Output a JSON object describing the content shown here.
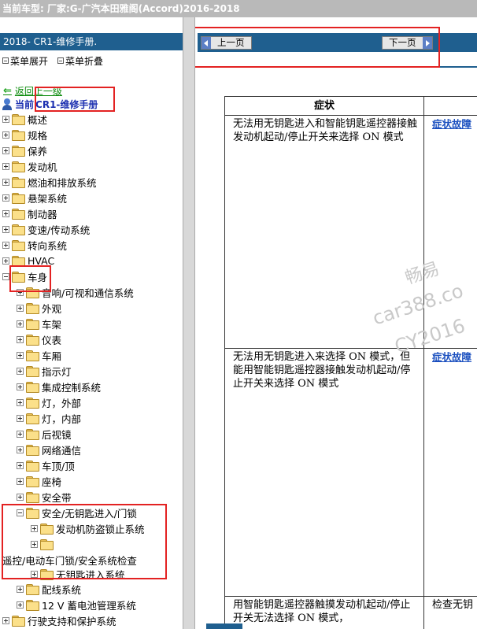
{
  "title_bar": "当前车型:  厂家:G-广汽本田雅阁(Accord)2016-2018",
  "sidebar": {
    "manual_header": "2018- CR1-维修手册.",
    "expand_all": "菜单展开",
    "collapse_all": "菜单折叠",
    "back": "返回上一级",
    "current_prefix": "当前",
    "current_name": "CR1-维修手册",
    "tree": [
      {
        "label": "概述"
      },
      {
        "label": "规格"
      },
      {
        "label": "保养"
      },
      {
        "label": "发动机"
      },
      {
        "label": "燃油和排放系统"
      },
      {
        "label": "悬架系统"
      },
      {
        "label": "制动器"
      },
      {
        "label": "变速/传动系统"
      },
      {
        "label": "转向系统"
      },
      {
        "label": "HVAC"
      },
      {
        "label": "车身"
      },
      {
        "label": "音响/可视和通信系统"
      },
      {
        "label": "外观"
      },
      {
        "label": "车架"
      },
      {
        "label": "仪表"
      },
      {
        "label": "车厢"
      },
      {
        "label": "指示灯"
      },
      {
        "label": "集成控制系统"
      },
      {
        "label": "灯，外部"
      },
      {
        "label": "灯，内部"
      },
      {
        "label": "后视镜"
      },
      {
        "label": "网络通信"
      },
      {
        "label": "车顶/顶"
      },
      {
        "label": "座椅"
      },
      {
        "label": "安全带"
      },
      {
        "label": "安全/无钥匙进入/门锁"
      },
      {
        "label": "发动机防盗锁止系统"
      },
      {
        "label": "遥控/电动车门锁/安全系统检查"
      },
      {
        "label": "无钥匙进入系统"
      },
      {
        "label": "配线系统"
      },
      {
        "label": "12 V 蓄电池管理系统"
      },
      {
        "label": "行驶支持和保护系统"
      }
    ]
  },
  "content": {
    "prev_page": "上一页",
    "next_page": "下一页",
    "table": {
      "header": "症状",
      "rows": [
        {
          "symptom": "无法用无钥匙进入和智能钥匙遥控器接触发动机起动/停止开关来选择 ON 模式",
          "action": "症状故障"
        },
        {
          "symptom": "无法用无钥匙进入来选择 ON 模式，但能用智能钥匙遥控器接触发动机起动/停止开关来选择 ON 模式",
          "action": "症状故障"
        },
        {
          "symptom": "用智能钥匙遥控器触摸发动机起动/停止开关无法选择 ON 模式，",
          "action": "检查无钥"
        }
      ]
    },
    "watermark": [
      "畅易",
      "car388.co",
      "CY2016"
    ]
  },
  "colors": {
    "header_blue": "#1f5f8f",
    "highlight_red": "#e32222",
    "link_blue": "#1a4fbf"
  }
}
